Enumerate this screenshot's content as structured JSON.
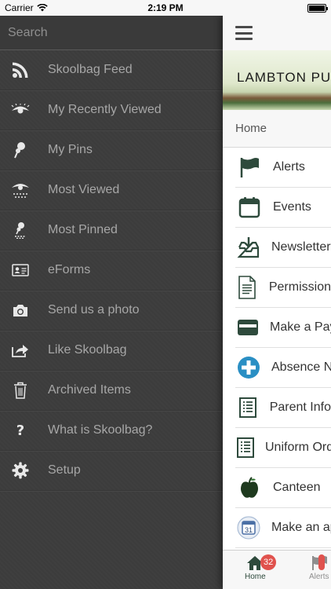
{
  "status_bar": {
    "carrier": "Carrier",
    "time": "2:19 PM"
  },
  "drawer": {
    "search_placeholder": "Search",
    "items": [
      {
        "label": "Skoolbag Feed",
        "icon": "rss-icon"
      },
      {
        "label": "My Recently Viewed",
        "icon": "eye-icon"
      },
      {
        "label": "My Pins",
        "icon": "pin-icon"
      },
      {
        "label": "Most Viewed",
        "icon": "eye-multiple-icon"
      },
      {
        "label": "Most Pinned",
        "icon": "pins-multiple-icon"
      },
      {
        "label": "eForms",
        "icon": "id-card-icon"
      },
      {
        "label": "Send us a photo",
        "icon": "camera-icon"
      },
      {
        "label": "Like Skoolbag",
        "icon": "share-icon"
      },
      {
        "label": "Archived Items",
        "icon": "trash-icon"
      },
      {
        "label": "What is Skoolbag?",
        "icon": "question-icon"
      },
      {
        "label": "Setup",
        "icon": "gear-icon"
      }
    ]
  },
  "panel": {
    "banner_text": "LAMBTON PU",
    "breadcrumb": "Home",
    "items": [
      {
        "label": "Alerts",
        "icon": "flag-icon"
      },
      {
        "label": "Events",
        "icon": "calendar-icon"
      },
      {
        "label": "Newsletters",
        "icon": "inbox-download-icon"
      },
      {
        "label": "Permission",
        "icon": "document-icon"
      },
      {
        "label": "Make a Pay",
        "icon": "credit-card-icon"
      },
      {
        "label": "Absence No",
        "icon": "plus-circle-icon"
      },
      {
        "label": "Parent Info",
        "icon": "form-icon"
      },
      {
        "label": "Uniform Ord",
        "icon": "form-icon"
      },
      {
        "label": "Canteen",
        "icon": "apple-icon"
      },
      {
        "label": "Make an ap",
        "icon": "calendar-31-icon"
      }
    ]
  },
  "tabbar": {
    "home_label": "Home",
    "home_badge": "32",
    "alerts_label": "Alerts",
    "alerts_badge": ""
  },
  "colors": {
    "drawer_bg": "#3d3d3d",
    "accent_green": "#2e4a3c",
    "badge_red": "#e0524d"
  }
}
